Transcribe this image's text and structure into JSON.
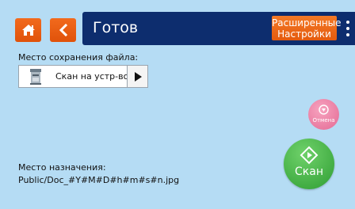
{
  "header": {
    "title": "Готов",
    "advanced_line1": "Расширенные",
    "advanced_line2": "Настройки"
  },
  "save_location": {
    "label": "Место сохранения файла:",
    "value": "Скан на устр-во"
  },
  "actions": {
    "cancel_label": "Отмена",
    "scan_label": "Скан"
  },
  "destination": {
    "label": "Место назначения:",
    "path": "Public/Doc_#Y#M#D#h#m#s#n.jpg"
  },
  "icons": {
    "home": "home-icon",
    "back": "chevron-left-icon",
    "more": "more-vertical-icon",
    "device": "scanner-device-icon",
    "arrow": "play-right-icon",
    "cancel": "stop-icon",
    "scan": "diamond-start-icon"
  },
  "colors": {
    "background": "#b5dcf4",
    "title_bar": "#0d2d6e",
    "accent_orange": "#e8600f",
    "scan_green": "#3aa83a",
    "cancel_pink": "#e8759c"
  }
}
